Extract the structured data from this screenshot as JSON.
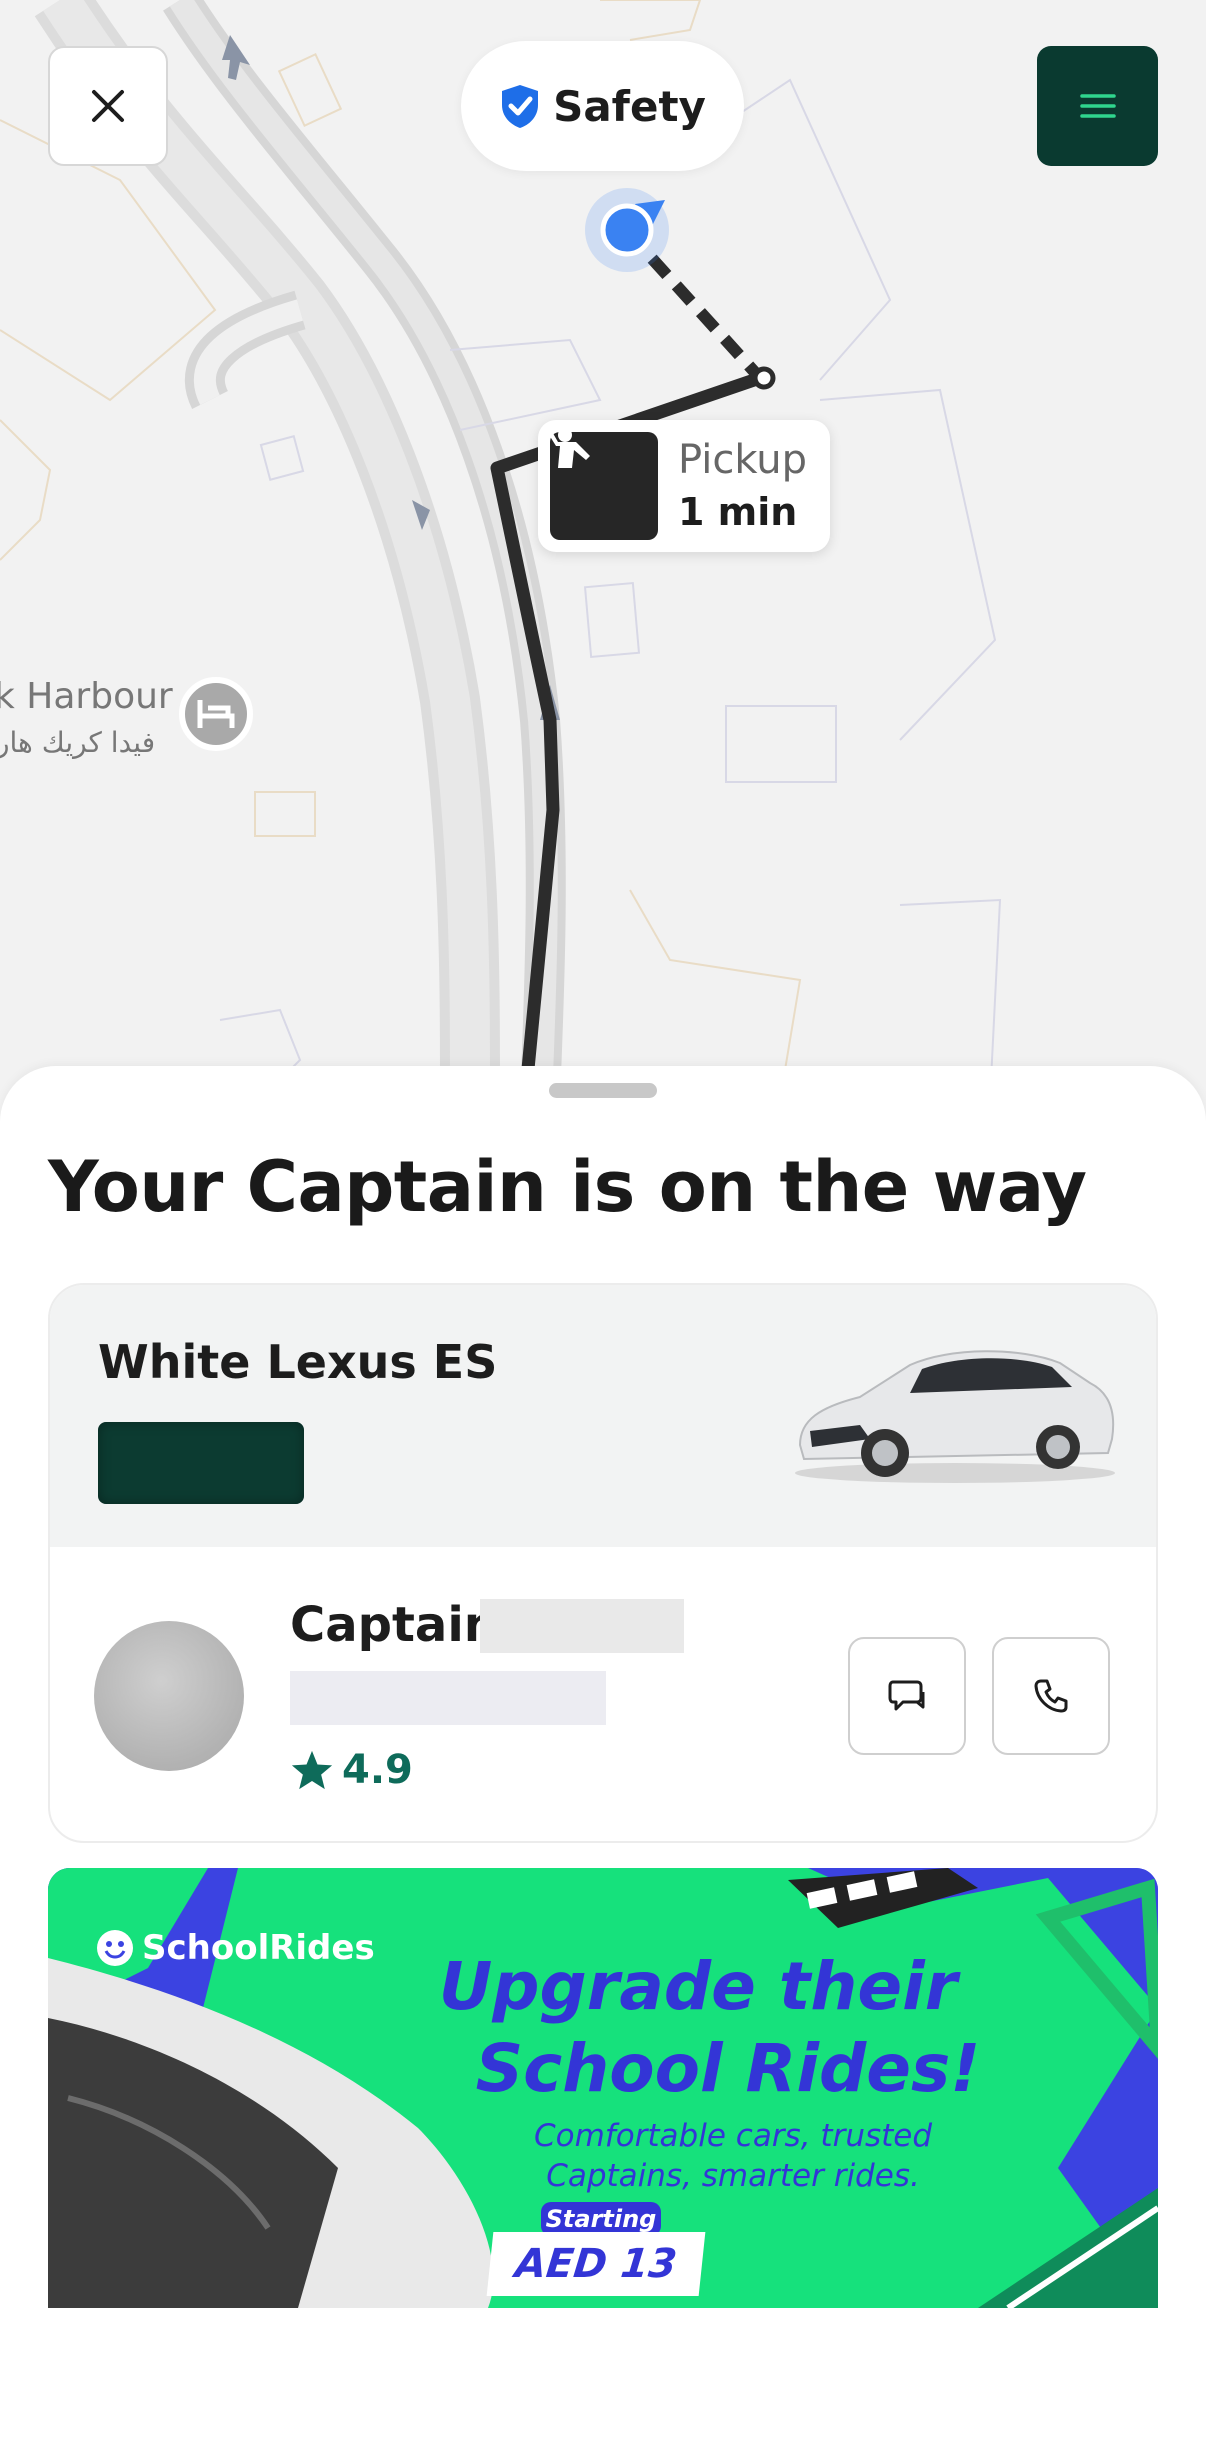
{
  "map": {
    "place_name_en": "k Harbour",
    "place_name_ar": "فيدا كريك هار",
    "pickup": {
      "label": "Pickup",
      "eta": "1 min"
    }
  },
  "top_bar": {
    "close_icon": "close-icon",
    "safety_label": "Safety",
    "safety_icon": "shield-check-icon",
    "menu_icon": "hamburger-menu-icon"
  },
  "sheet": {
    "title": "Your Captain is on the way",
    "car": {
      "name": "White Lexus ES",
      "plate_color": "#0c3b31"
    },
    "captain": {
      "label": "Captain",
      "rating": "4.9"
    },
    "actions": {
      "chat_icon": "chat-icon",
      "call_icon": "phone-icon"
    }
  },
  "promo": {
    "brand": "SchoolRides",
    "headline_line1": "Upgrade their",
    "headline_line2": "School Rides!",
    "sub_line1": "Comfortable cars, trusted",
    "sub_line2": "Captains, smarter rides.",
    "starting_label": "Starting",
    "price": "AED 13",
    "colors": {
      "green": "#16e17c",
      "blue": "#3b43e1"
    }
  },
  "colors": {
    "accent_dark_green": "#0a3a30",
    "rating_green": "#0e6b5a",
    "location_blue": "#3a82f2"
  }
}
